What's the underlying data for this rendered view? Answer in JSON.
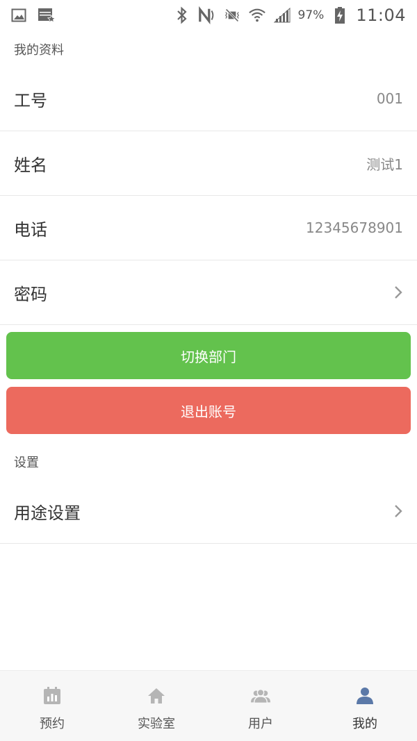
{
  "status_bar": {
    "battery_percent": "97%",
    "time": "11:04"
  },
  "profile_section": {
    "title": "我的资料",
    "rows": [
      {
        "label": "工号",
        "value": "001"
      },
      {
        "label": "姓名",
        "value": "测试1"
      },
      {
        "label": "电话",
        "value": "12345678901"
      },
      {
        "label": "密码",
        "value": ""
      }
    ]
  },
  "actions": {
    "switch_department": "切换部门",
    "logout": "退出账号"
  },
  "settings_section": {
    "title": "设置",
    "rows": [
      {
        "label": "用途设置"
      }
    ]
  },
  "tab_bar": {
    "active_tab": "我的",
    "tabs": [
      {
        "label": "预约",
        "icon": "calendar-chart-icon"
      },
      {
        "label": "实验室",
        "icon": "home-icon"
      },
      {
        "label": "用户",
        "icon": "users-icon"
      },
      {
        "label": "我的",
        "icon": "user-icon"
      }
    ]
  },
  "colors": {
    "switch_button": "#63c24d",
    "logout_button": "#ec6a5e",
    "active_tab_icon": "#5b79a8",
    "inactive_tab_icon": "#b5b5b5"
  }
}
